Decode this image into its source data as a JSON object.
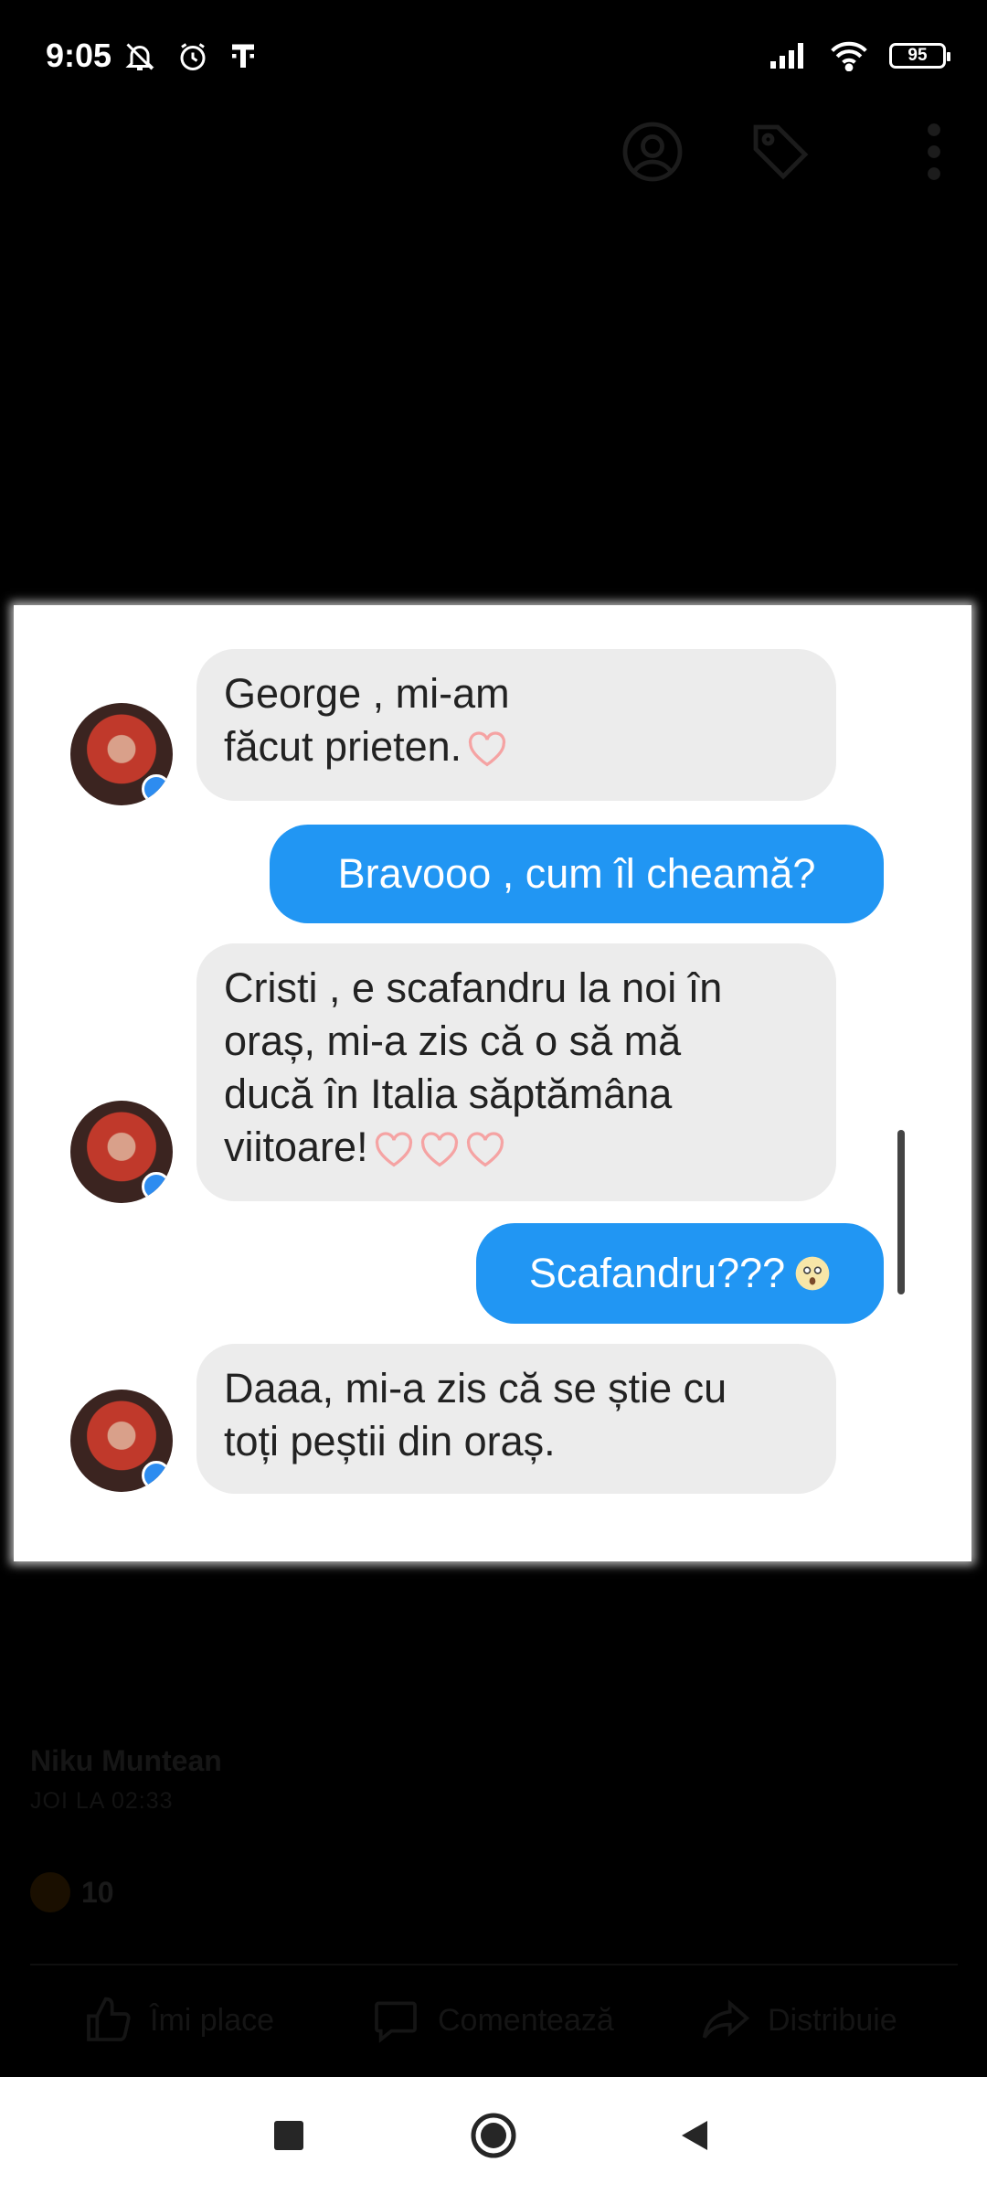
{
  "status_bar": {
    "time": "9:05",
    "battery": "95",
    "icons": [
      "notifications-off-icon",
      "alarm-icon",
      "t-mobile-icon",
      "signal-icon",
      "wifi-icon",
      "battery-icon"
    ]
  },
  "post": {
    "author": "Niku Muntean",
    "date": "JOI LA 02:33",
    "reaction_count": "10",
    "actions": {
      "like": "Îmi place",
      "comment": "Comentează",
      "share": "Distribuie"
    }
  },
  "chat": {
    "messages": [
      {
        "from": "them",
        "lines": [
          "George , mi-am",
          "făcut prieten."
        ]
      },
      {
        "from": "me",
        "text": "Bravooo , cum  îl cheamă?"
      },
      {
        "from": "them",
        "lines": [
          "Cristi , e scafandru la noi în",
          "oraș, mi-a zis că o să mă",
          "ducă în Italia săptămâna",
          "viitoare!"
        ]
      },
      {
        "from": "me",
        "text": "Scafandru???"
      },
      {
        "from": "them",
        "lines": [
          "Daaa, mi-a zis că se știe cu",
          "toți peștii din oraș."
        ]
      }
    ]
  },
  "colors": {
    "outgoing_bubble": "#2196f3",
    "incoming_bubble": "#ececec",
    "heart": "#f5a3a3",
    "background": "#000000"
  }
}
